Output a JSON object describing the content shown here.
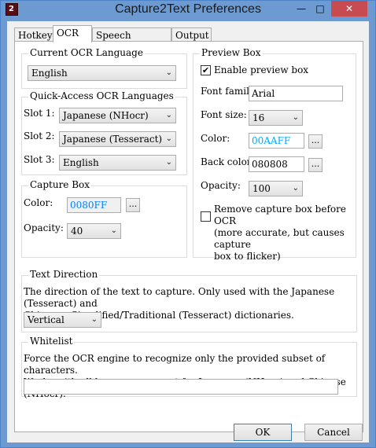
{
  "window": {
    "title": "Capture2Text Preferences",
    "app_icon_text": "2",
    "minimize": "—",
    "maximize": "□",
    "close": "✕"
  },
  "tabs": [
    "Hotkeys",
    "OCR",
    "Speech Recognition",
    "Output"
  ],
  "current_ocr": {
    "title": "Current OCR Language",
    "value": "English"
  },
  "quick_access": {
    "title": "Quick-Access OCR Languages",
    "slots": [
      {
        "label": "Slot 1:",
        "value": "Japanese (NHocr)"
      },
      {
        "label": "Slot 2:",
        "value": "Japanese (Tesseract)"
      },
      {
        "label": "Slot 3:",
        "value": "English"
      }
    ]
  },
  "capture_box": {
    "title": "Capture Box",
    "color_label": "Color:",
    "color_value": "0080FF",
    "color_value_color": "#0080FF",
    "browse": "...",
    "opacity_label": "Opacity:",
    "opacity_value": "40"
  },
  "preview_box": {
    "title": "Preview Box",
    "enable_label": "Enable preview box",
    "enable_checked": "✔",
    "font_family_label": "Font family:",
    "font_family_value": "Arial",
    "font_size_label": "Font size:",
    "font_size_value": "16",
    "color_label": "Color:",
    "color_value": "00AAFF",
    "color_value_color": "#00AAFF",
    "back_color_label": "Back color:",
    "back_color_value": "080808",
    "browse": "...",
    "opacity_label": "Opacity:",
    "opacity_value": "100",
    "remove_label_1": "Remove capture box before OCR",
    "remove_label_2": "(more accurate, but causes capture",
    "remove_label_3": "box to flicker)"
  },
  "text_direction": {
    "title": "Text Direction",
    "desc_1": "The direction of the text to capture. Only used with the Japanese (Tesseract) and",
    "desc_2": "Chinese - Simplified/Traditional (Tesseract) dictionaries.",
    "value": "Vertical"
  },
  "whitelist": {
    "title": "Whitelist",
    "desc_1": "Force the OCR engine to recognize only the provided subset of characters.",
    "desc_2": "Works with all languages accept for Japanese (NHocr) and Chinese (NHocr).",
    "value": ""
  },
  "buttons": {
    "ok": "OK",
    "cancel": "Cancel"
  },
  "chevron": "⌄"
}
